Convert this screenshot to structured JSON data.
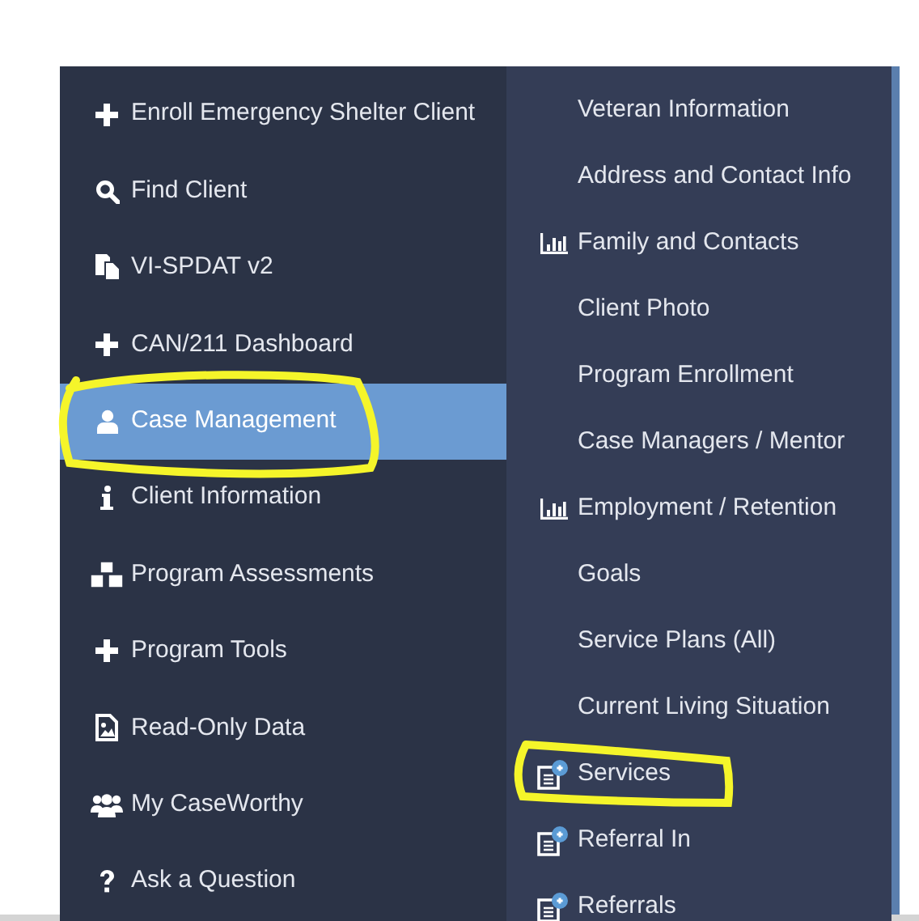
{
  "main_menu": {
    "items": [
      {
        "label": "Enroll Emergency Shelter Client",
        "kind": "plus",
        "selected": false,
        "circled": false
      },
      {
        "label": "Find Client",
        "kind": "search",
        "selected": false,
        "circled": false
      },
      {
        "label": "VI-SPDAT v2",
        "kind": "copy",
        "selected": false,
        "circled": false
      },
      {
        "label": "CAN/211 Dashboard",
        "kind": "plus",
        "selected": false,
        "circled": false
      },
      {
        "label": "Case Management",
        "kind": "user",
        "selected": true,
        "circled": true
      },
      {
        "label": "Client Information",
        "kind": "info",
        "selected": false,
        "circled": false
      },
      {
        "label": "Program Assessments",
        "kind": "cubes",
        "selected": false,
        "circled": false
      },
      {
        "label": "Program Tools",
        "kind": "plus",
        "selected": false,
        "circled": false
      },
      {
        "label": "Read-Only Data",
        "kind": "image",
        "selected": false,
        "circled": false
      },
      {
        "label": "My CaseWorthy",
        "kind": "users",
        "selected": false,
        "circled": false
      },
      {
        "label": "Ask a Question",
        "kind": "question",
        "selected": false,
        "circled": false
      }
    ]
  },
  "submenu": {
    "items": [
      {
        "label": "Veteran Information",
        "kind": "plain",
        "circled": false
      },
      {
        "label": "Address and Contact Info",
        "kind": "plain",
        "circled": false
      },
      {
        "label": "Family and Contacts",
        "kind": "chart",
        "circled": false
      },
      {
        "label": "Client Photo",
        "kind": "plain",
        "circled": false
      },
      {
        "label": "Program Enrollment",
        "kind": "plain",
        "circled": false
      },
      {
        "label": "Case Managers / Mentor",
        "kind": "plain",
        "circled": false
      },
      {
        "label": "Employment / Retention",
        "kind": "chart",
        "circled": false
      },
      {
        "label": "Goals",
        "kind": "plain",
        "circled": false
      },
      {
        "label": "Service Plans (All)",
        "kind": "plain",
        "circled": false
      },
      {
        "label": "Current Living Situation",
        "kind": "plain",
        "circled": false
      },
      {
        "label": "Services",
        "kind": "docplus",
        "circled": true
      },
      {
        "label": "Referral In",
        "kind": "docplus",
        "circled": false
      },
      {
        "label": "Referrals",
        "kind": "docplus",
        "circled": false
      }
    ]
  }
}
